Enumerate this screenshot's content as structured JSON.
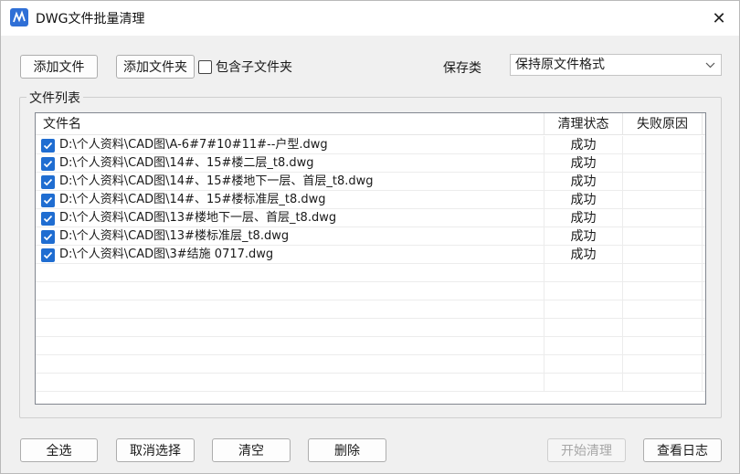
{
  "window": {
    "title": "DWG文件批量清理",
    "close_glyph": "✕"
  },
  "toolbar": {
    "add_file": "添加文件",
    "add_folder": "添加文件夹",
    "include_subfolders": "包含子文件夹",
    "include_subfolders_checked": false,
    "save_label": "保存类",
    "save_format": "保持原文件格式"
  },
  "file_list": {
    "group_label": "文件列表",
    "columns": [
      "文件名",
      "清理状态",
      "失败原因"
    ],
    "rows": [
      {
        "checked": true,
        "name": "D:\\个人资料\\CAD图\\A-6#7#10#11#--户型.dwg",
        "status": "成功",
        "reason": ""
      },
      {
        "checked": true,
        "name": "D:\\个人资料\\CAD图\\14#、15#楼二层_t8.dwg",
        "status": "成功",
        "reason": ""
      },
      {
        "checked": true,
        "name": "D:\\个人资料\\CAD图\\14#、15#楼地下一层、首层_t8.dwg",
        "status": "成功",
        "reason": ""
      },
      {
        "checked": true,
        "name": "D:\\个人资料\\CAD图\\14#、15#楼标准层_t8.dwg",
        "status": "成功",
        "reason": ""
      },
      {
        "checked": true,
        "name": "D:\\个人资料\\CAD图\\13#楼地下一层、首层_t8.dwg",
        "status": "成功",
        "reason": ""
      },
      {
        "checked": true,
        "name": "D:\\个人资料\\CAD图\\13#楼标准层_t8.dwg",
        "status": "成功",
        "reason": ""
      },
      {
        "checked": true,
        "name": "D:\\个人资料\\CAD图\\3#结施 0717.dwg",
        "status": "成功",
        "reason": ""
      }
    ]
  },
  "footer": {
    "select_all": "全选",
    "deselect": "取消选择",
    "clear": "清空",
    "delete": "删除",
    "start": "开始清理",
    "view_log": "查看日志"
  },
  "colors": {
    "accent": "#1f6dd1",
    "window_bg": "#f0f0f0",
    "disabled_text": "#a6a6a6"
  }
}
